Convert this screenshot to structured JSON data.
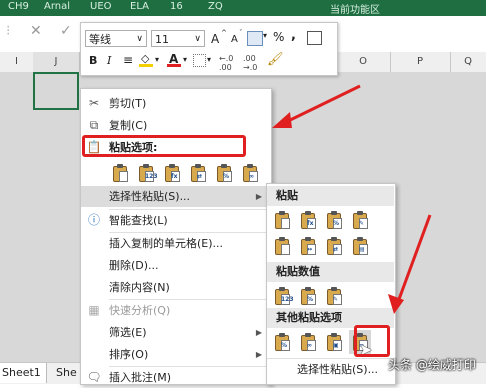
{
  "colors": {
    "excel_green": "#217346",
    "arrow_red": "#e02020"
  },
  "ribbon": {
    "items": [
      "CH9",
      "Arnal",
      "UEO",
      "ELA",
      "16",
      "ZQ",
      "当前功能区"
    ]
  },
  "formula_bar": {
    "cancel_icon": "x-icon",
    "enter_icon": "check-icon"
  },
  "columns": [
    "I",
    "J",
    "",
    "",
    "",
    "",
    "",
    "",
    "",
    "O",
    "P",
    "Q"
  ],
  "mini_toolbar": {
    "font_name": "等线",
    "font_size": "11",
    "bold": "B",
    "italic": "I",
    "grow_font": "A",
    "shrink_font": "A",
    "percent": "%",
    "comma": ","
  },
  "context_menu": {
    "cut": "剪切(T)",
    "copy": "复制(C)",
    "paste_options": "粘贴选项:",
    "paste_special": "选择性粘贴(S)...",
    "smart_lookup": "智能查找(L)",
    "insert_copied": "插入复制的单元格(E)...",
    "delete": "删除(D)...",
    "clear": "清除内容(N)",
    "quick_analysis": "快速分析(Q)",
    "filter": "筛选(E)",
    "sort": "排序(O)",
    "insert_comment": "插入批注(M)"
  },
  "submenu": {
    "paste_header": "粘贴",
    "paste_values_header": "粘贴数值",
    "other_paste_header": "其他粘贴选项",
    "paste_special_link": "选择性粘贴(S)..."
  },
  "sheet_tabs": [
    "Sheet1",
    "She"
  ],
  "watermark": "头条 @绘威打印"
}
